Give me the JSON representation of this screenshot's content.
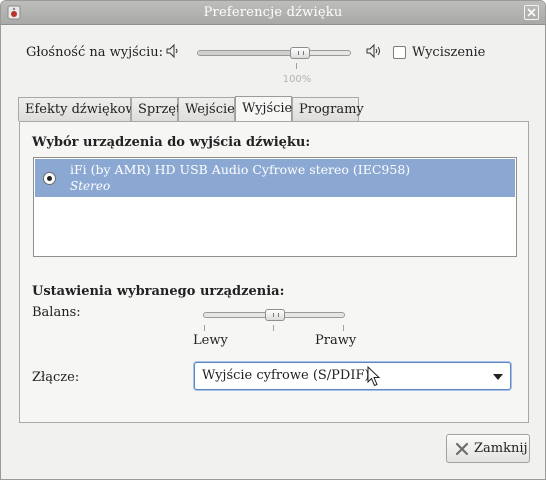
{
  "window": {
    "title": "Preferencje dźwięku"
  },
  "output_volume": {
    "label": "Głośność na wyjściu:",
    "value_text": "100%",
    "level_fraction": 0.66,
    "mute_label": "Wyciszenie",
    "mute_checked": false
  },
  "tabs": [
    {
      "label": "Efekty dźwiękowe",
      "active": false
    },
    {
      "label": "Sprzęt",
      "active": false
    },
    {
      "label": "Wejście",
      "active": false
    },
    {
      "label": "Wyjście",
      "active": true
    },
    {
      "label": "Programy",
      "active": false
    }
  ],
  "output_tab": {
    "device_section_title": "Wybór urządzenia do wyjścia dźwięku:",
    "devices": [
      {
        "name": "iFi (by AMR) HD USB Audio Cyfrowe stereo (IEC958)",
        "profile": "Stereo",
        "selected": true
      }
    ],
    "settings_section_title": "Ustawienia wybranego urządzenia:",
    "balance": {
      "label": "Balans:",
      "left_label": "Lewy",
      "right_label": "Prawy",
      "position_fraction": 0.5
    },
    "connector": {
      "label": "Złącze:",
      "selected": "Wyjście cyfrowe (S/PDIF)"
    }
  },
  "footer": {
    "close_label": "Zamknij"
  },
  "icons": {
    "app": "speaker-app-icon",
    "window_close": "close-icon",
    "volume_low": "speaker-low-icon",
    "volume_high": "speaker-high-icon",
    "close_button": "close-x-icon",
    "cursor": "mouse-pointer-icon"
  },
  "colors": {
    "selection": "#8ba8d3",
    "focus": "#5e86c4",
    "titlebar": "#b3b3b1"
  }
}
